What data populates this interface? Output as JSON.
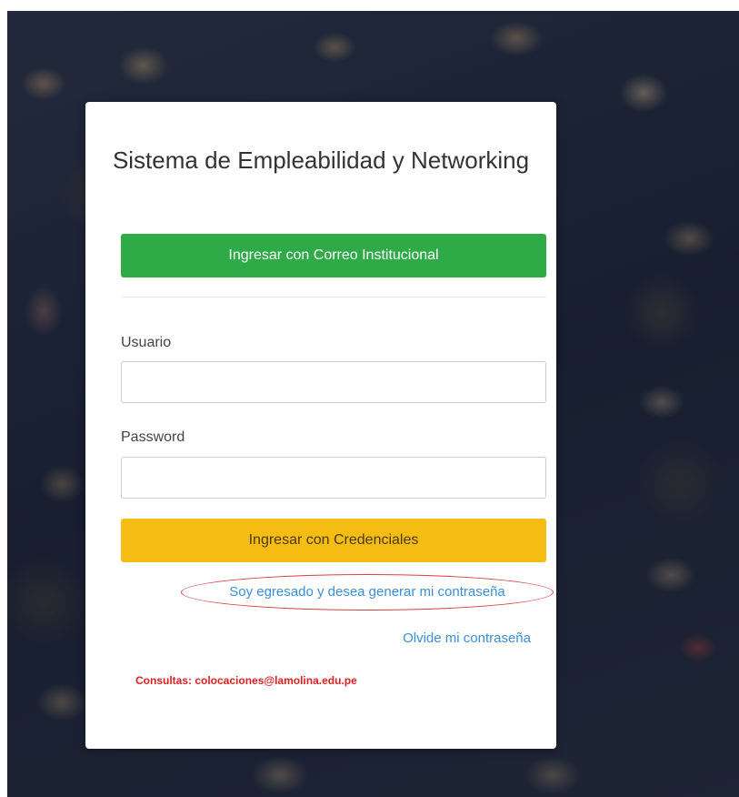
{
  "app": {
    "title": "Sistema de Empleabilidad y Networking"
  },
  "login": {
    "institutional_button_label": "Ingresar con Correo Institucional",
    "username_label": "Usuario",
    "username_value": "",
    "password_label": "Password",
    "password_value": "",
    "credentials_button_label": "Ingresar con Credenciales",
    "generate_password_link": "Soy egresado y desea generar mi contraseña",
    "forgot_password_link": "Olvide mi contraseña",
    "contact_text": "Consultas: colocaciones@lamolina.edu.pe"
  },
  "colors": {
    "green_button": "#2eaa47",
    "yellow_button": "#f5bd13",
    "link": "#3a8fd8",
    "contact": "#e02020",
    "highlight_ellipse": "#d94040"
  }
}
